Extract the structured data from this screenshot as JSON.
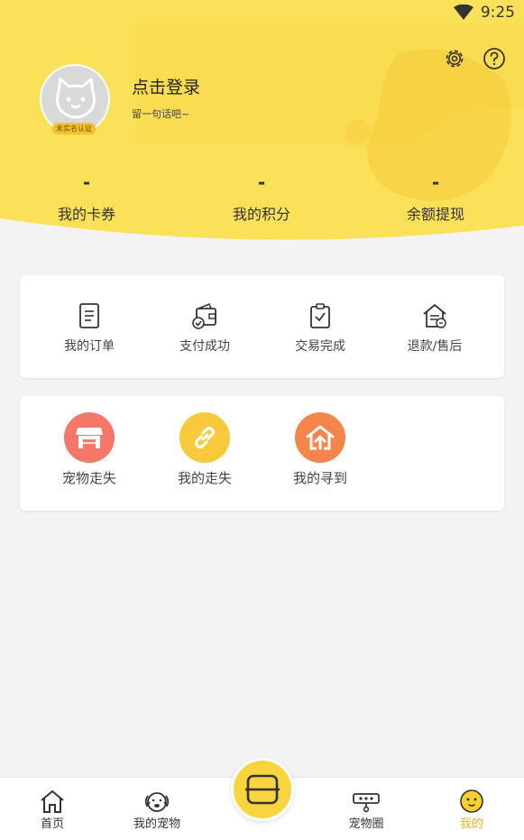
{
  "status_bar": {
    "time": "9:25"
  },
  "profile": {
    "login_text": "点击登录",
    "motto": "留一句话吧~",
    "badge": "未实名认证"
  },
  "stats": [
    {
      "value": "-",
      "label": "我的卡券"
    },
    {
      "value": "-",
      "label": "我的积分"
    },
    {
      "value": "-",
      "label": "余额提现"
    }
  ],
  "orders": [
    {
      "label": "我的订单",
      "icon": "order-icon"
    },
    {
      "label": "支付成功",
      "icon": "wallet-check-icon"
    },
    {
      "label": "交易完成",
      "icon": "clipboard-check-icon"
    },
    {
      "label": "退款/售后",
      "icon": "refund-house-icon"
    }
  ],
  "pets": [
    {
      "label": "宠物走失",
      "icon": "store-icon",
      "color": "#f5776a"
    },
    {
      "label": "我的走失",
      "icon": "link-icon",
      "color": "#f8c93a"
    },
    {
      "label": "我的寻到",
      "icon": "home-arrow-icon",
      "color": "#f5854a"
    }
  ],
  "tabs": [
    {
      "label": "首页",
      "icon": "home-icon"
    },
    {
      "label": "我的宠物",
      "icon": "dog-face-icon"
    },
    {
      "label": "宠物圈",
      "icon": "pet-circle-icon"
    },
    {
      "label": "我的",
      "icon": "smiley-icon",
      "active": true
    }
  ],
  "colors": {
    "accent": "#f8d53e",
    "active_tab": "#e8b51e",
    "background": "#f3f3f3"
  }
}
